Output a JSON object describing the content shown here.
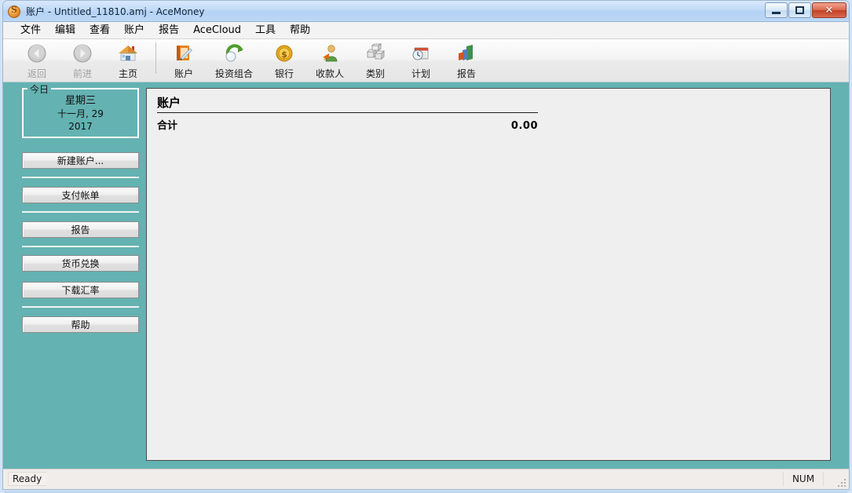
{
  "window": {
    "title": "账户 - Untitled_11810.amj - AceMoney",
    "app_icon": "coin-s-icon",
    "controls": {
      "minimize": "minimize-button",
      "maximize": "maximize-button",
      "close_label": "✕"
    },
    "accent_teal": "#64b2b2",
    "titlebar_blue": "#b4d2f5",
    "close_red": "#c24027"
  },
  "menu": {
    "items": [
      {
        "label": "文件"
      },
      {
        "label": "编辑"
      },
      {
        "label": "查看"
      },
      {
        "label": "账户"
      },
      {
        "label": "报告"
      },
      {
        "label": "AceCloud"
      },
      {
        "label": "工具"
      },
      {
        "label": "帮助"
      }
    ]
  },
  "toolbar": {
    "items": [
      {
        "label": "返回",
        "icon": "back-arrow-icon",
        "enabled": false
      },
      {
        "label": "前进",
        "icon": "forward-arrow-icon",
        "enabled": false
      },
      {
        "label": "主页",
        "icon": "home-icon",
        "enabled": true
      },
      {
        "label": "账户",
        "icon": "account-book-icon",
        "enabled": true
      },
      {
        "label": "投资组合",
        "icon": "portfolio-refresh-icon",
        "enabled": true
      },
      {
        "label": "银行",
        "icon": "bank-coin-icon",
        "enabled": true
      },
      {
        "label": "收款人",
        "icon": "payee-person-icon",
        "enabled": true
      },
      {
        "label": "类别",
        "icon": "categories-blocks-icon",
        "enabled": true
      },
      {
        "label": "计划",
        "icon": "schedule-calendar-icon",
        "enabled": true
      },
      {
        "label": "报告",
        "icon": "reports-chart-icon",
        "enabled": true
      }
    ]
  },
  "sidebar": {
    "today_group_title": "今日",
    "date": {
      "weekday": "星期三",
      "monthday": "十一月, 29",
      "year": "2017"
    },
    "buttons": [
      {
        "label": "新建账户..."
      },
      {
        "label": "支付帐单"
      },
      {
        "label": "报告"
      },
      {
        "label": "货币兑换"
      },
      {
        "label": "下载汇率"
      },
      {
        "label": "帮助"
      }
    ]
  },
  "main": {
    "title": "账户",
    "total_label": "合计",
    "total_value": "0.00"
  },
  "statusbar": {
    "message": "Ready",
    "num_indicator": "NUM"
  }
}
